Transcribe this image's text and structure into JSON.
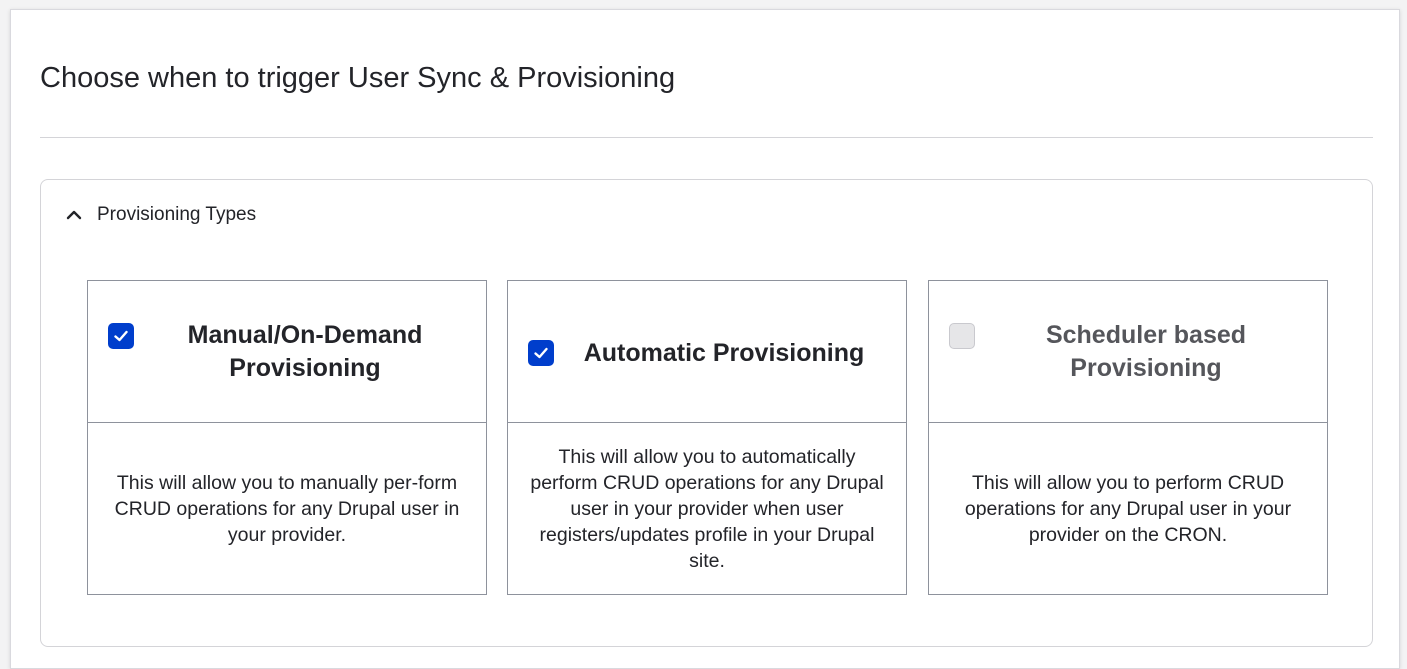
{
  "page": {
    "title": "Choose when to trigger User Sync & Provisioning"
  },
  "section": {
    "label": "Provisioning Types",
    "expanded": true,
    "icon": "chevron-up-icon"
  },
  "colors": {
    "accent": "#003ecc",
    "border": "#8e929c",
    "disabled_text": "#55565b"
  },
  "cards": [
    {
      "title": "Manual/On-Demand Provisioning",
      "checked": true,
      "description": "This will allow you to manually per-form CRUD operations for any Drupal user in your provider."
    },
    {
      "title": "Automatic Provisioning",
      "checked": true,
      "description": "This will allow you to automatically perform CRUD operations for any Drupal user in your provider when user registers/updates profile in your Drupal site."
    },
    {
      "title": "Scheduler based Provisioning",
      "checked": false,
      "description": "This will allow you to perform CRUD operations for any Drupal user in your provider on the CRON."
    }
  ]
}
